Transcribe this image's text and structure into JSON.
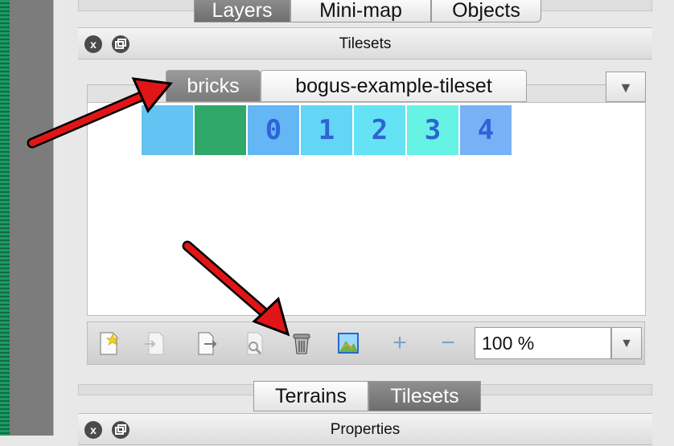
{
  "top_tabs": [
    {
      "label": "Layers",
      "active": true
    },
    {
      "label": "Mini-map",
      "active": false
    },
    {
      "label": "Objects",
      "active": false
    }
  ],
  "tilesets_panel": {
    "title": "Tilesets",
    "close_icon": "x",
    "float_icon": "float-icon",
    "tabs": [
      {
        "label": "bricks",
        "active": true
      },
      {
        "label": "bogus-example-tileset",
        "active": false
      }
    ],
    "dropdown_icon": "▼",
    "tiles": [
      "",
      "",
      "0",
      "1",
      "2",
      "3",
      "4"
    ],
    "tile_colors": [
      "#63c3f2",
      "#2fa86a",
      "#64b6f4",
      "#63d5f5",
      "#65e3f4",
      "#67f2e6",
      "#79b1f6"
    ],
    "toolbar": {
      "icons": [
        "new-tileset-icon",
        "import-tileset-icon",
        "export-tileset-icon",
        "tileset-properties-icon",
        "remove-tileset-icon",
        "edit-terrain-icon",
        "add-tiles-icon",
        "remove-tiles-icon"
      ],
      "plus": "+",
      "minus": "−",
      "zoom_value": "100 %",
      "zoom_arrow": "▼"
    }
  },
  "bottom_tabs": [
    {
      "label": "Terrains",
      "active": false
    },
    {
      "label": "Tilesets",
      "active": true
    }
  ],
  "properties_panel": {
    "title": "Properties"
  },
  "colors": {
    "annotation_arrow": "#e01616",
    "accent_tab": "#7a7a7a"
  }
}
